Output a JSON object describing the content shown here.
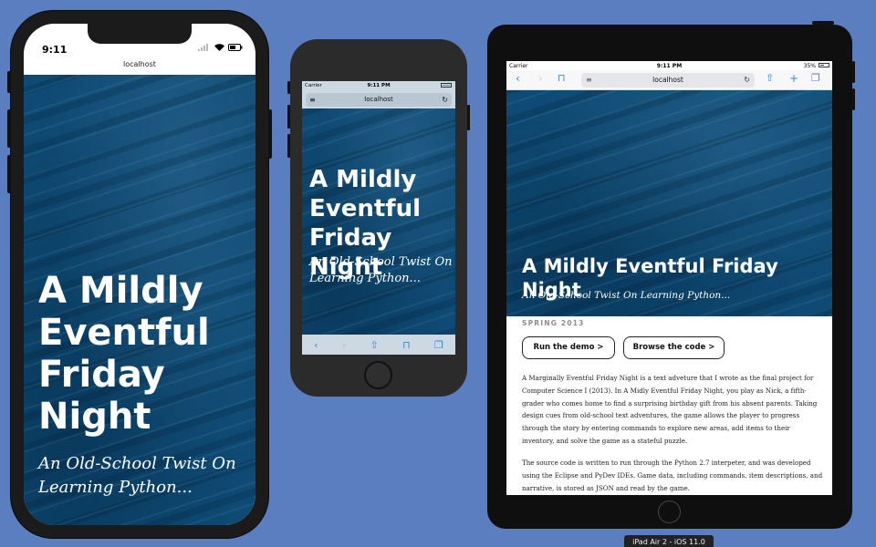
{
  "site": {
    "title": "A Mildly Eventful Friday Night",
    "subtitle": "An Old-School Twist On Learning Python..."
  },
  "iphone_x": {
    "time": "9:11",
    "url": "localhost"
  },
  "iphone_8": {
    "carrier": "Carrier",
    "time": "9:11 PM",
    "url": "localhost"
  },
  "ipad": {
    "carrier": "Carrier",
    "time": "9:11 PM",
    "battery_percent": "35%",
    "url": "localhost",
    "meta": "SPRING 2013",
    "buttons": {
      "demo": "Run the demo >",
      "code": "Browse the code >"
    },
    "paragraphs": [
      "A Marginally Eventful Friday Night is a text adveture that I wrote as the final project for Computer Science I (2013). In A Midly Eventful Friday Night, you play as Nick, a fifth-grader who comes home to find a surprising birthday gift from his absent parents. Taking design cues from old-school text adventures, the game allows the player to progress through the story by entering commands to explore new areas, add items to their inventory, and solve the game as a stateful puzzle.",
      "The source code is written to run through the Python 2.7 interpeter, and was developed using the Eclipse and PyDev IDEs. Game data, including commands, item descriptions, and narrative, is stored as JSON and read by the game."
    ]
  },
  "device_label": "iPad Air 2 - iOS 11.0",
  "colors": {
    "background": "#5b7ec0",
    "hero": "#0e4a73",
    "safari_blue": "#3a83e0"
  }
}
